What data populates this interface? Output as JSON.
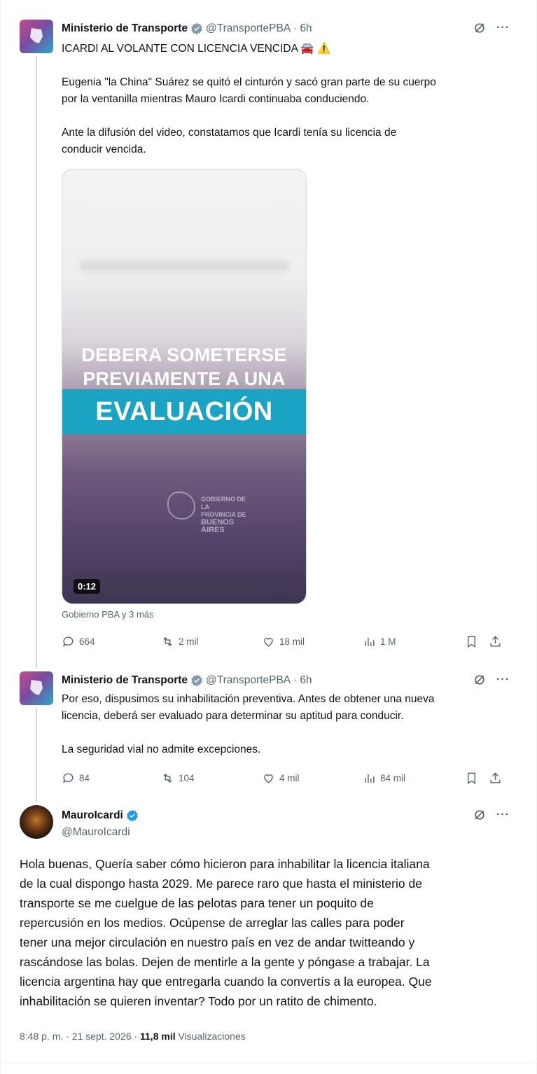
{
  "tweets": [
    {
      "author": "Ministerio de Transporte",
      "handle": "@TransportePBA",
      "time": "6h",
      "lines": [
        "ICARDI AL VOLANTE CON LICENCIA VENCIDA 🚘 ⚠️",
        "Eugenia \"la China\" Suárez se quitó el cinturón y sacó gran parte de su cuerpo",
        "por la ventanilla mientras Mauro Icardi continuaba conduciendo.",
        "Ante la difusión del video, constatamos que Icardi tenía su licencia de",
        "conducir vencida."
      ],
      "video": {
        "line1": "DEBERA SOMETERSE",
        "line2": "PREVIAMENTE A UNA",
        "highlight": "EVALUACIÓN",
        "logo_text_1": "GOBIERNO DE LA",
        "logo_text_2": "PROVINCIA DE",
        "logo_text_3": "BUENOS",
        "logo_text_4": "AIRES",
        "duration": "0:12"
      },
      "credit": "Gobierno PBA y 3 más",
      "stats": {
        "replies": "664",
        "reposts": "2 mil",
        "likes": "18 mil",
        "views": "1 M"
      }
    },
    {
      "author": "Ministerio de Transporte",
      "handle": "@TransportePBA",
      "time": "6h",
      "lines": [
        "Por eso, dispusimos su inhabilitación preventiva. Antes de obtener una nueva",
        "licencia, deberá ser evaluado para determinar su aptitud para conducir.",
        "La seguridad vial no admite excepciones."
      ],
      "stats": {
        "replies": "84",
        "reposts": "104",
        "likes": "4 mil",
        "views": "84 mil"
      }
    },
    {
      "author": "MauroIcardi",
      "handle": "@MauroIcardi",
      "lines": [
        "Hola buenas, Quería saber cómo hicieron para inhabilitar la licencia italiana",
        "de la cual dispongo hasta 2029. Me parece raro que hasta el ministerio de",
        "transporte se me cuelgue de las pelotas para tener un poquito de",
        "repercusión en los medios. Ocúpense de arreglar las calles para poder",
        "tener una mejor circulación en nuestro país en vez de andar twitteando y",
        "rascándose las bolas. Dejen de mentirle a la gente y póngase a trabajar. La",
        "licencia argentina hay que entregarla cuando la convertís a la europea. Que",
        "inhabilitación se quieren inventar? Todo por un ratito de chimento."
      ],
      "timestamp": "8:48 p. m. · 21 sept. 2026 · ",
      "views_count": "11,8 mil",
      "views_label": " Visualizaciones"
    }
  ],
  "colors": {
    "verified": "#1d9bf0",
    "text": "#0f1419",
    "muted": "#536471",
    "teal": "#1ba3c3"
  },
  "icons": [
    "verified-badge-icon",
    "grok-icon",
    "more-icon",
    "reply-icon",
    "repost-icon",
    "like-icon",
    "views-icon",
    "bookmark-icon",
    "share-icon"
  ]
}
